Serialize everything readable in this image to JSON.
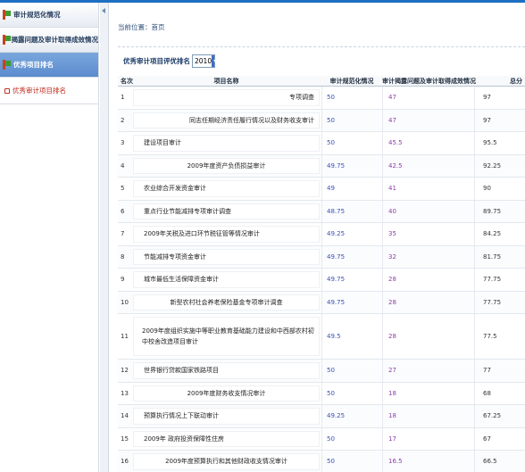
{
  "sidebar": {
    "items": [
      {
        "label": "审计规范化情况",
        "active": false
      },
      {
        "label": "揭露问题及审计取得成效情况",
        "active": false
      },
      {
        "label": "优秀项目排名",
        "active": true
      }
    ],
    "subitems": [
      {
        "label": "优秀审计项目排名"
      }
    ]
  },
  "main": {
    "breadcrumb": "当前位置：首页",
    "filter": {
      "label": "优秀审计项目评优排名",
      "year": "2010"
    },
    "table": {
      "headers": {
        "rank": "名次",
        "name": "项目名称",
        "standard": "审计规范化情况",
        "achievement": "审计揭露问题及审计取得成效情况",
        "total": "总分"
      },
      "rows": [
        {
          "rank": "1",
          "name": "专项调查",
          "standard": "50",
          "achievement": "47",
          "total": "97",
          "align": "right"
        },
        {
          "rank": "2",
          "name": "同志任期经济责任履行情况以及财务收支审计",
          "standard": "50",
          "achievement": "47",
          "total": "97",
          "align": "right"
        },
        {
          "rank": "3",
          "name": "建设项目审计",
          "standard": "50",
          "achievement": "45.5",
          "total": "95.5",
          "align": "left"
        },
        {
          "rank": "4",
          "name": "2009年度资产负债损益审计",
          "standard": "49.75",
          "achievement": "42.5",
          "total": "92.25",
          "align": "center"
        },
        {
          "rank": "5",
          "name": "农业综合开发资金审计",
          "standard": "49",
          "achievement": "41",
          "total": "90",
          "align": "left"
        },
        {
          "rank": "6",
          "name": "重点行业节能减排专项审计调查",
          "standard": "48.75",
          "achievement": "40",
          "total": "89.75",
          "align": "left"
        },
        {
          "rank": "7",
          "name": "2009年关税及进口环节税征管等情况审计",
          "standard": "49.25",
          "achievement": "35",
          "total": "84.25",
          "align": "left"
        },
        {
          "rank": "8",
          "name": "节能减排专项资金审计",
          "standard": "49.75",
          "achievement": "32",
          "total": "81.75",
          "align": "left"
        },
        {
          "rank": "9",
          "name": "城市最低生活保障资金审计",
          "standard": "49.75",
          "achievement": "28",
          "total": "77.75",
          "align": "left"
        },
        {
          "rank": "10",
          "name": "新型农村社会养老保险基金专项审计调查",
          "standard": "49.75",
          "achievement": "28",
          "total": "77.75",
          "align": "center"
        },
        {
          "rank": "11",
          "name": "2009年度组织实施中等职业教育基础能力建设和中西部农村初中校舍改造项目审计",
          "standard": "49.5",
          "achievement": "28",
          "total": "77.5",
          "align": "left",
          "tall": true
        },
        {
          "rank": "12",
          "name": "世界银行贷款国家铁路项目",
          "standard": "50",
          "achievement": "27",
          "total": "77",
          "align": "left"
        },
        {
          "rank": "13",
          "name": "2009年度财务收支情况审计",
          "standard": "50",
          "achievement": "18",
          "total": "68",
          "align": "center"
        },
        {
          "rank": "14",
          "name": "预算执行情况上下联动审计",
          "standard": "49.25",
          "achievement": "18",
          "total": "67.25",
          "align": "left"
        },
        {
          "rank": "15",
          "name": "2009年  政府投资保障性住房",
          "standard": "50",
          "achievement": "17",
          "total": "67",
          "align": "left"
        },
        {
          "rank": "16",
          "name": "2009年度预算执行和其他财政收支情况审计",
          "standard": "50",
          "achievement": "16.5",
          "total": "66.5",
          "align": "center"
        }
      ]
    }
  }
}
